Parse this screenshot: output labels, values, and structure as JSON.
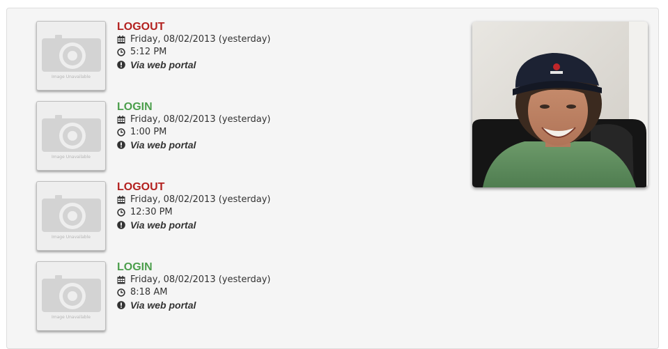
{
  "placeholder": {
    "caption": "Image Unavailable"
  },
  "entries": [
    {
      "action": "LOGOUT",
      "type": "logout",
      "date": "Friday, 08/02/2013 (yesterday)",
      "time": "5:12 PM",
      "via": "Via web portal"
    },
    {
      "action": "LOGIN",
      "type": "login",
      "date": "Friday, 08/02/2013 (yesterday)",
      "time": "1:00 PM",
      "via": "Via web portal"
    },
    {
      "action": "LOGOUT",
      "type": "logout",
      "date": "Friday, 08/02/2013 (yesterday)",
      "time": "12:30 PM",
      "via": "Via web portal"
    },
    {
      "action": "LOGIN",
      "type": "login",
      "date": "Friday, 08/02/2013 (yesterday)",
      "time": "8:18 AM",
      "via": "Via web portal"
    }
  ],
  "colors": {
    "logout": "#b3211f",
    "login": "#4c9e4c"
  },
  "icons": {
    "date": "calendar-icon",
    "time": "clock-icon",
    "via": "exclamation-circle-icon"
  }
}
